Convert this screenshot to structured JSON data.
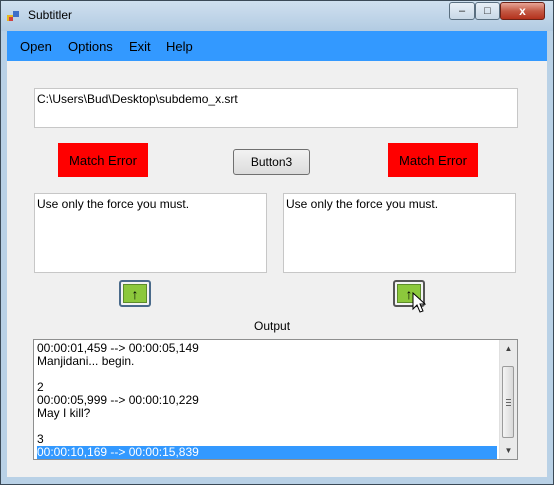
{
  "window": {
    "title": "Subtitler"
  },
  "titlebar_controls": {
    "minimize": "–",
    "maximize": "□",
    "close": "x"
  },
  "menu": [
    "Open",
    "Options",
    "Exit",
    "Help"
  ],
  "file_path": "C:\\Users\\Bud\\Desktop\\subdemo_x.srt",
  "labels": {
    "match_left": "Match Error",
    "match_right": "Match Error",
    "button3": "Button3",
    "output": "Output"
  },
  "text_left": "Use only the force you must.",
  "text_right": "Use only the force you must.",
  "up_arrow": "↑",
  "output_lines": [
    "00:00:01,459 --> 00:00:05,149",
    "Manjidani... begin.",
    "",
    "2",
    "00:00:05,999 --> 00:00:10,229",
    "May I kill?",
    "",
    "3",
    "00:00:10,169 --> 00:00:15,839"
  ],
  "selected_line": 8,
  "colors": {
    "menubar": "#3399ff",
    "match_error": "#ff0000",
    "up_button": "#8cc83c",
    "selection": "#3399ff"
  }
}
